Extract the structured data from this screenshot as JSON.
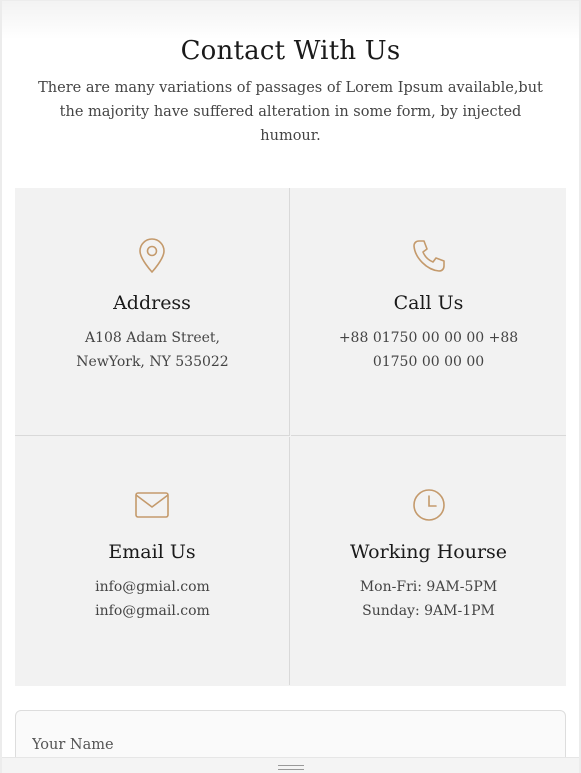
{
  "colors": {
    "accent": "#c49a6c",
    "card_background": "#f2f2f2",
    "heading": "#1a1a1a",
    "body_text": "#444444"
  },
  "section": {
    "title": "Contact With Us",
    "subtitle": "There are many variations of passages of Lorem Ipsum available,but the majority have suffered alteration in some form, by injected humour."
  },
  "cards": [
    {
      "icon": "map-pin-icon",
      "title": "Address",
      "lines": [
        "A108 Adam Street,",
        "NewYork, NY 535022"
      ]
    },
    {
      "icon": "phone-icon",
      "title": "Call Us",
      "lines": [
        "+88 01750 00 00 00 +88",
        "01750 00 00 00"
      ]
    },
    {
      "icon": "envelope-icon",
      "title": "Email Us",
      "lines": [
        "info@gmial.com",
        "info@gmail.com"
      ]
    },
    {
      "icon": "clock-icon",
      "title": "Working Hourse",
      "lines": [
        "Mon-Fri: 9AM-5PM",
        "Sunday: 9AM-1PM"
      ]
    }
  ],
  "form": {
    "name_placeholder": "Your Name"
  }
}
